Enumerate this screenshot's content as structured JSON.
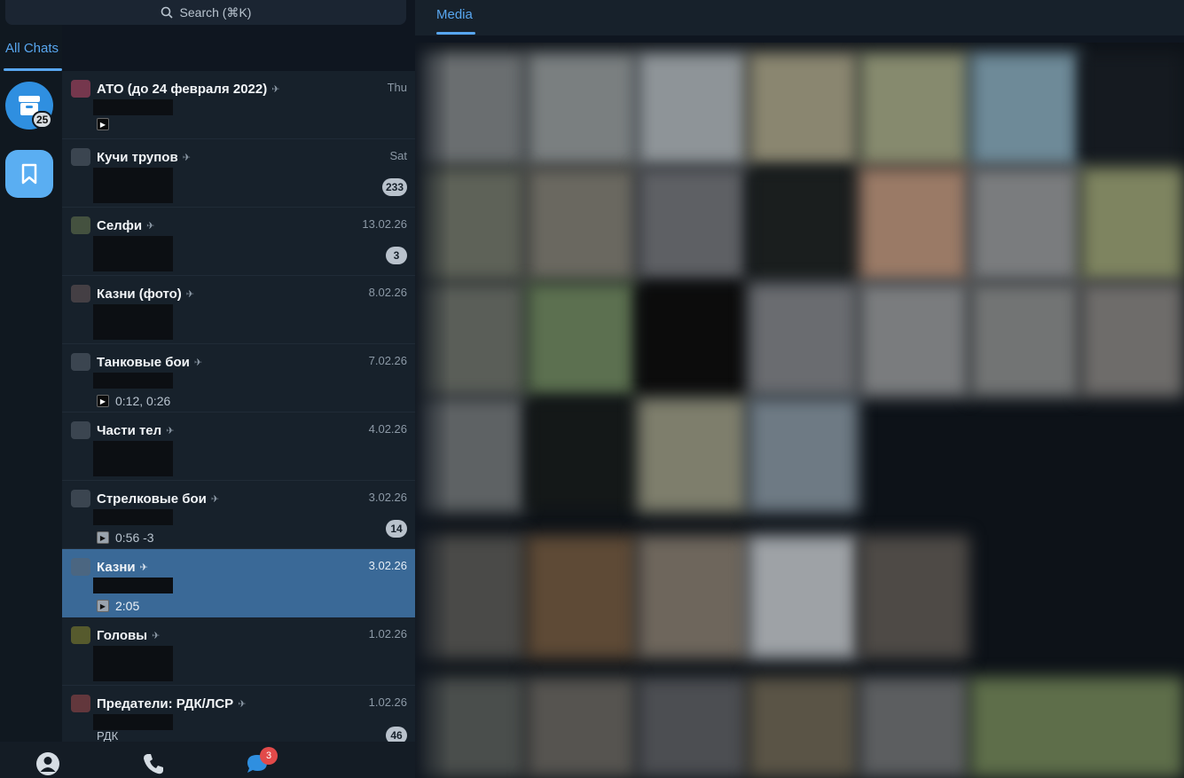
{
  "search": {
    "label": "Search (⌘K)"
  },
  "tabs": {
    "all_chats": "All Chats",
    "media": "Media"
  },
  "folders": {
    "archive_count": "25"
  },
  "chats": [
    {
      "title": "АТО (до 24 февраля 2022)",
      "date": "Thu",
      "preview": "",
      "badge": "",
      "avatar_color": "#c24a6a"
    },
    {
      "title": "Кучи трупов",
      "date": "Sat",
      "preview": "",
      "badge": "233",
      "avatar_color": "#5a6470"
    },
    {
      "title": "Селфи",
      "date": "13.02.26",
      "preview": "",
      "badge": "3",
      "avatar_color": "#6a7a50"
    },
    {
      "title": "Казни (фото)",
      "date": "8.02.26",
      "preview": "",
      "badge": "",
      "avatar_color": "#6a5a5a"
    },
    {
      "title": "Танковые бои",
      "date": "7.02.26",
      "preview": "0:12, 0:26",
      "badge": "",
      "avatar_color": "#5a6470"
    },
    {
      "title": "Части тел",
      "date": "4.02.26",
      "preview": "",
      "badge": "",
      "avatar_color": "#5a6470"
    },
    {
      "title": "Стрелковые бои",
      "date": "3.02.26",
      "preview": "0:56 -3",
      "badge": "14",
      "avatar_color": "#5a6470"
    },
    {
      "title": "Казни",
      "date": "3.02.26",
      "preview": "2:05",
      "badge": "",
      "avatar_color": "#5a6470"
    },
    {
      "title": "Головы",
      "date": "1.02.26",
      "preview": "",
      "badge": "",
      "avatar_color": "#8a8a30"
    },
    {
      "title": "Предатели: РДК/ЛСР",
      "date": "1.02.26",
      "preview": "РДК",
      "badge": "46",
      "avatar_color": "#a04a4a"
    }
  ],
  "bottom_bar": {
    "chats_badge": "3"
  },
  "colors": {
    "accent": "#58a6ef",
    "selected_row": "#3a6997",
    "archive": "#2f8fe0",
    "saved": "#5aaef2",
    "unread_badge": "#e24a4a"
  }
}
